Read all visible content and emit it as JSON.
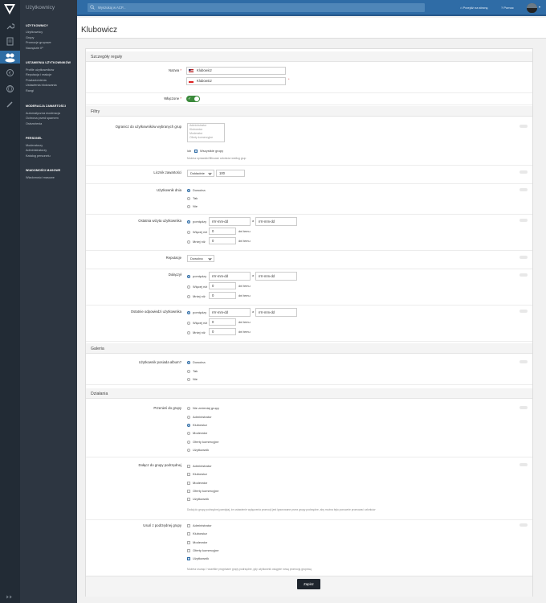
{
  "app": {
    "section_title": "Użytkownicy"
  },
  "sidebar": {
    "groups": [
      {
        "title": "UŻYTKOWNICY",
        "items": [
          "Użytkownicy",
          "Grupy",
          "Promocje grupowe",
          "Narzędzie IP"
        ]
      },
      {
        "title": "USTAWIENIA UŻYTKOWNIKÓW",
        "items": [
          "Profile użytkowników",
          "Reputacja i reakcje",
          "Powiadomienia",
          "Ustawienia blokowania",
          "Rangi"
        ]
      },
      {
        "title": "MODERACJA ZAWARTOŚCI",
        "items": [
          "Automatyczna moderacja",
          "Ochrona przed spamem",
          "Ostrzeżenia"
        ]
      },
      {
        "title": "PERSONEL",
        "items": [
          "Moderatorzy",
          "Administratorzy",
          "Katalog personelu"
        ]
      },
      {
        "title": "WIADOMOŚCI MASOWE",
        "items": [
          "Wiadomości masowe"
        ]
      }
    ],
    "icons": [
      "logo-icon",
      "wrench-icon",
      "document-icon",
      "users-icon",
      "euro-icon",
      "globe-icon",
      "brush-icon"
    ]
  },
  "topbar": {
    "search_placeholder": "Wyszukaj w ACP...",
    "visit_site": "Przejdź na stronę",
    "help": "Pomoc"
  },
  "page": {
    "title": "Klubowicz"
  },
  "details": {
    "section": "Szczegóły reguły",
    "name_label": "Nazwa",
    "name_en": "Klubowicz",
    "name_pl": "Klubowicz",
    "enabled_label": "Włączone"
  },
  "filters": {
    "section": "Filtry",
    "groups_label": "Ogranicz do użytkowników wybranych grup",
    "group_options": [
      "Administrator",
      "Klubowicz",
      "Moderator",
      "Oferty komercyjne"
    ],
    "or_label": "lub",
    "all_groups": "Wszystkie grupy",
    "groups_hint": "Możesz sprawdzić/filtrować członków według grup",
    "content_count_label": "Licznik zawartości",
    "content_count_mode": "Dokładnie",
    "content_count_value": "100",
    "user_of_day_label": "Użytkownik dnia",
    "any": "Dowolna",
    "yes": "Tak",
    "no": "Nie",
    "last_visit_label": "Ostatnia wizyta użytkownika",
    "between": "pomiędzy",
    "date_placeholder": "rrrr-mm-dd",
    "and": "a",
    "more_than": "Więcej niż",
    "less_than": "Mniej niż",
    "days_ago": "dni temu",
    "zero": "0",
    "reputation_label": "Reputacje",
    "reputation_value": "Dowolna",
    "joined_label": "Dołączył",
    "last_post_label": "Ostatnie odpowiedzi użytkownika"
  },
  "gallery": {
    "section": "Galeria",
    "album_label": "Użytkownik posiada album?",
    "any": "Dowolna",
    "yes": "Tak",
    "no": "Nie"
  },
  "actions": {
    "section": "Działania",
    "move_label": "Przenieś do grupy",
    "move_options": [
      "Nie zmieniaj grupy",
      "Administrator",
      "Klubowicz",
      "Moderator",
      "Oferty komercyjne",
      "Użytkownik"
    ],
    "move_selected": 2,
    "add_label": "Dołącz do grupy podrzędnej",
    "add_options": [
      "Administrator",
      "Klubowicz",
      "Moderator",
      "Oferty komercyjne",
      "Użytkownik"
    ],
    "add_hint": "Dodaj do grupy podrzędnej pamiętaj, że ustawienie wyłączenia promocji jest ignorowane przez grupy podrzędne, aby można było ponownie promować członków",
    "remove_label": "Usuń z podrzędnej grupy",
    "remove_options": [
      "Administrator",
      "Klubowicz",
      "Moderator",
      "Oferty komercyjne",
      "Użytkownik"
    ],
    "remove_checked": 4,
    "remove_hint": "Możesz usunąć / wszelkie przypisane grupy podrzędne, gdy użytkownik osiągnie nową promocję grupową"
  },
  "footer": {
    "save": "Zapisz"
  },
  "colors": {
    "accent": "#2f6ca6",
    "sidebar": "#2d3641",
    "iconbar": "#222b35",
    "toggle": "#3b8a3b"
  }
}
